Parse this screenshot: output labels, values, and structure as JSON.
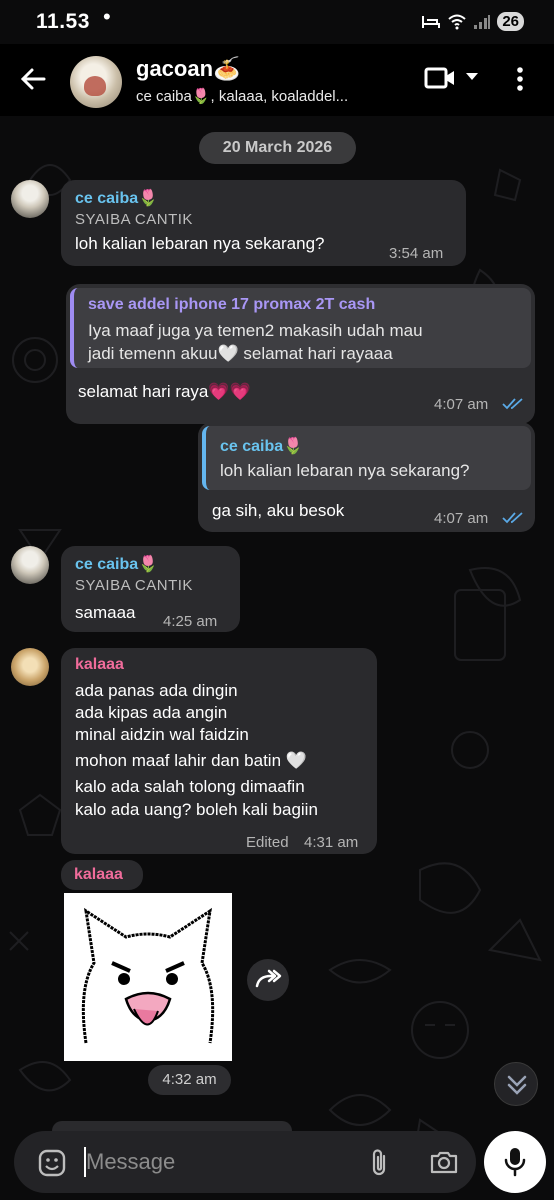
{
  "status_bar": {
    "time": "11.53",
    "dot": "•",
    "battery": "26"
  },
  "header": {
    "title": "gacoan🍝",
    "subtitle": "ce caiba🌷, kalaaa, koaladdel...",
    "icons": [
      "back-arrow-icon",
      "video-call-icon",
      "chevron-down-icon",
      "more-vertical-icon"
    ]
  },
  "date_chip": "20 March 2026",
  "messages": [
    {
      "sender": "ce caiba🌷",
      "sender_subtitle": "SYAIBA CANTIK",
      "text": "loh kalian lebaran nya sekarang?",
      "time": "3:54 am"
    },
    {
      "reply_to": {
        "sender": "save addel iphone 17 promax 2T cash",
        "line1": "Iya maaf juga ya temen2 makasih udah mau",
        "line2": "jadi temenn akuu🤍 selamat hari rayaaa"
      },
      "text": "selamat hari raya💗💗",
      "time": "4:07 am"
    },
    {
      "reply_to": {
        "sender": "ce caiba🌷",
        "line1": "loh kalian lebaran nya sekarang?"
      },
      "text": "ga sih, aku besok",
      "time": "4:07 am"
    },
    {
      "sender": "ce caiba🌷",
      "sender_subtitle": "SYAIBA CANTIK",
      "text": "samaaa",
      "time": "4:25 am"
    },
    {
      "sender": "kalaaa",
      "lines": [
        "ada panas ada dingin",
        "ada kipas ada angin",
        "minal aidzin wal faidzin",
        "mohon maaf lahir dan batin 🤍",
        "kalo ada salah tolong dimaafin",
        "kalo ada uang? boleh kali bagiin"
      ],
      "edited": "Edited",
      "time": "4:31 am"
    },
    {
      "sender": "kalaaa",
      "sticker": "angry-white-cat-sticker",
      "time": "4:32 am"
    }
  ],
  "input": {
    "placeholder": "Message"
  },
  "colors": {
    "accent_blue": "#69c3ee",
    "accent_pink": "#f06c9b",
    "bubble": "#2a2a2d",
    "background": "#0b0b0c"
  }
}
